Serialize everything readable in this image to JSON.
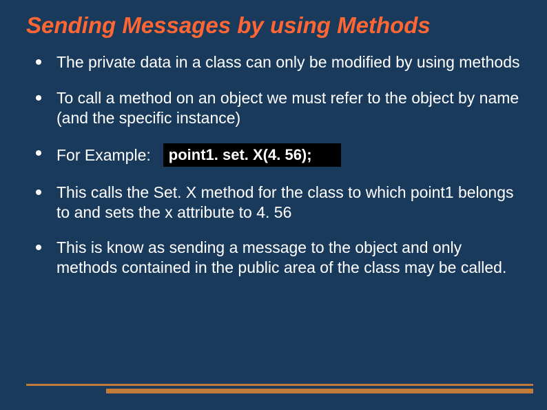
{
  "title": "Sending Messages by using Methods",
  "bullets": {
    "b0": "The private data in a class can only be modified by using methods",
    "b1": "To call a method on an object we must refer to the object by name (and the specific instance)",
    "b2_label": "For Example:",
    "b2_code": "point1. set. X(4. 56);",
    "b3": "This calls the Set. X method for the class to which point1 belongs to and sets the x attribute to 4. 56",
    "b4": "This is know as sending a message to the object and only methods contained  in the public area of the class may be called."
  }
}
